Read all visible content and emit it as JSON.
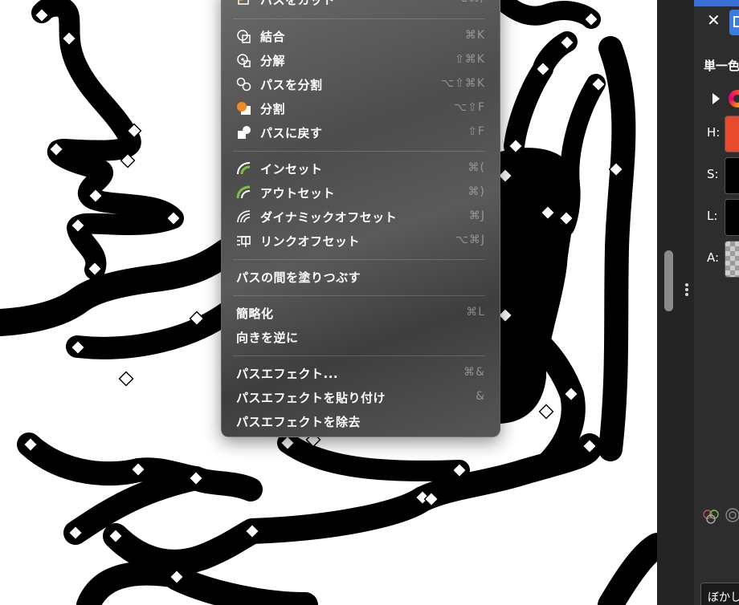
{
  "menu": {
    "partial_item": {
      "label": "パスをカット",
      "shortcut": "⌥⌘/"
    },
    "items": [
      {
        "label": "結合",
        "shortcut": "⌘K",
        "icon": "combine-icon"
      },
      {
        "label": "分解",
        "shortcut": "⇧⌘K",
        "icon": "separate-icon"
      },
      {
        "label": "パスを分割",
        "shortcut": "⌥⇧⌘K",
        "icon": "split-path-icon"
      },
      {
        "label": "分割",
        "shortcut": "⌥⇧F",
        "icon": "divide-icon"
      },
      {
        "label": "パスに戻す",
        "shortcut": "⇧F",
        "icon": "convert-to-path-icon"
      },
      {
        "label": "インセット",
        "shortcut": "⌘(",
        "icon": "inset-icon"
      },
      {
        "label": "アウトセット",
        "shortcut": "⌘)",
        "icon": "outset-icon"
      },
      {
        "label": "ダイナミックオフセット",
        "shortcut": "⌘J",
        "icon": "dynamic-offset-icon"
      },
      {
        "label": "リンクオフセット",
        "shortcut": "⌥⌘J",
        "icon": "linked-offset-icon"
      },
      {
        "label": "パスの間を塗りつぶす",
        "shortcut": ""
      },
      {
        "label": "簡略化",
        "shortcut": "⌘L"
      },
      {
        "label": "向きを逆に",
        "shortcut": ""
      },
      {
        "label": "パスエフェクト...",
        "shortcut": "⌘&"
      },
      {
        "label": "パスエフェクトを貼り付け",
        "shortcut": "&"
      },
      {
        "label": "パスエフェクトを除去",
        "shortcut": ""
      }
    ]
  },
  "panel": {
    "close_icon": "close-icon",
    "title": "単一色",
    "hsla": [
      {
        "label": "H:",
        "color": "#e84a2e"
      },
      {
        "label": "S:",
        "color": "#000000"
      },
      {
        "label": "L:",
        "color": "#000000"
      },
      {
        "label": "A:",
        "color": "checkerboard"
      }
    ],
    "blur_label": "ぼかし"
  },
  "colors": {
    "menu_background": "#555555",
    "accent_orange": "#f08a24",
    "accent_green": "#7ac143",
    "panel_background": "#2d2d2d",
    "selection_blue": "#3a7de0"
  }
}
